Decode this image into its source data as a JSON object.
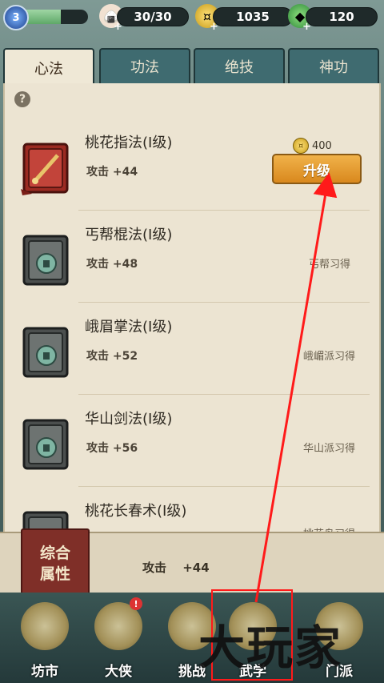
{
  "status": {
    "level": "3",
    "stamina": "30/30",
    "coins": "1035",
    "jade": "120"
  },
  "tabs": [
    "心法",
    "功法",
    "绝技",
    "神功"
  ],
  "skills": [
    {
      "name": "桃花指法(I级)",
      "stat": "攻击 +44",
      "cost": "400",
      "action": "升级"
    },
    {
      "name": "丐帮棍法(I级)",
      "stat": "攻击 +48",
      "source": "丐帮习得"
    },
    {
      "name": "峨眉掌法(I级)",
      "stat": "攻击 +52",
      "source": "峨嵋派习得"
    },
    {
      "name": "华山剑法(I级)",
      "stat": "攻击 +56",
      "source": "华山派习得"
    },
    {
      "name": "桃花长春术(I级)",
      "stat": "",
      "source": "桃花岛习得"
    }
  ],
  "attribute": {
    "badge_line1": "综合",
    "badge_line2": "属性",
    "stat": "攻击　 +44"
  },
  "nav": [
    {
      "label": "坊市",
      "badge": false
    },
    {
      "label": "大侠",
      "badge": true
    },
    {
      "label": "挑战",
      "badge": false
    },
    {
      "label": "武学",
      "badge": false
    },
    {
      "label": "门派",
      "badge": false
    }
  ],
  "watermark": "大玩家",
  "colors": {
    "accent": "#e39427",
    "highlight": "#ff1a1a",
    "panel": "#ece4d2"
  }
}
